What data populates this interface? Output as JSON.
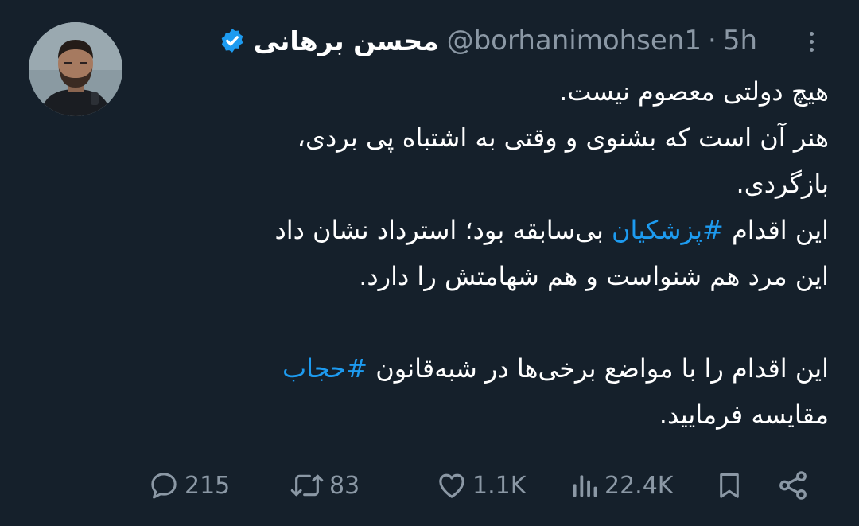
{
  "author": {
    "display_name": "محسن برهانی",
    "handle": "@borhanimohsen1",
    "separator": "·",
    "time": "5h",
    "verified_icon": "verified-badge-icon",
    "accent_color": "#1d9bf0"
  },
  "tweet": {
    "line1": "هیچ دولتی معصوم نیست.",
    "line2": "هنر آن است که بشنوی و وقتی به اشتباه پی بردی،",
    "line3": "بازگردی.",
    "line4_before": "این اقدام ",
    "hashtag1": "#پزشکیان",
    "line4_after": " بی‌سابقه بود؛ استرداد نشان داد",
    "line5": "این مرد هم شنواست و هم شهامتش را دارد.",
    "line6_before": "این اقدام را با مواضع برخی‌ها در شبه‌قانون ",
    "hashtag2": "#حجاب",
    "line7": "مقایسه فرمایید."
  },
  "actions": {
    "replies": "215",
    "reposts": "83",
    "likes": "1.1K",
    "views": "22.4K",
    "icons": [
      "reply-icon",
      "repost-icon",
      "like-icon",
      "views-icon",
      "bookmark-icon",
      "share-icon"
    ]
  },
  "colors": {
    "background": "#15202b",
    "text": "#ffffff",
    "muted": "#8b98a5",
    "link": "#1d9bf0"
  }
}
